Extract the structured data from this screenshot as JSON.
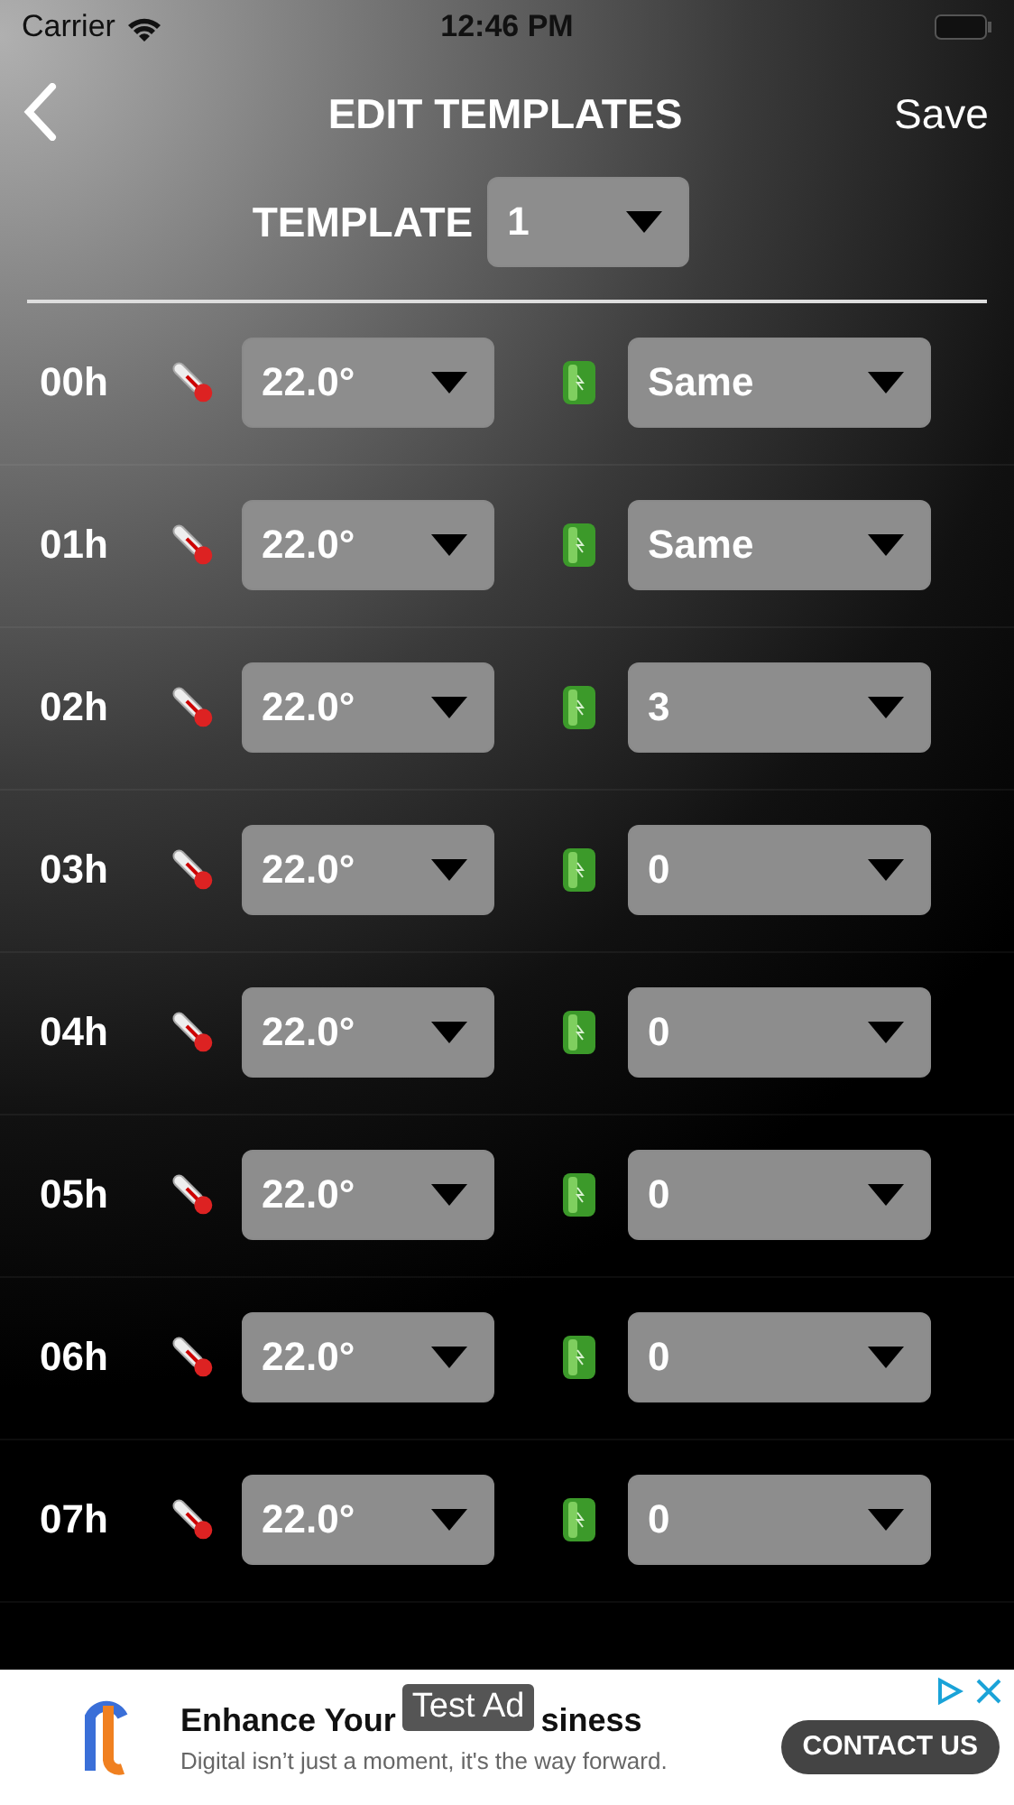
{
  "status_bar": {
    "carrier": "Carrier",
    "time": "12:46 PM"
  },
  "header": {
    "title": "EDIT TEMPLATES",
    "save": "Save"
  },
  "template": {
    "label": "TEMPLATE",
    "value": "1"
  },
  "rows": [
    {
      "hour": "00h",
      "temperature": "22.0°",
      "battery": "Same"
    },
    {
      "hour": "01h",
      "temperature": "22.0°",
      "battery": "Same"
    },
    {
      "hour": "02h",
      "temperature": "22.0°",
      "battery": "3"
    },
    {
      "hour": "03h",
      "temperature": "22.0°",
      "battery": "0"
    },
    {
      "hour": "04h",
      "temperature": "22.0°",
      "battery": "0"
    },
    {
      "hour": "05h",
      "temperature": "22.0°",
      "battery": "0"
    },
    {
      "hour": "06h",
      "temperature": "22.0°",
      "battery": "0"
    },
    {
      "hour": "07h",
      "temperature": "22.0°",
      "battery": "0"
    }
  ],
  "ad": {
    "label": "Test Ad",
    "headline_start": "Enhance Your",
    "headline_end": "siness",
    "description": "Digital isn’t just a moment, it's the way forward.",
    "cta": "CONTACT US"
  }
}
